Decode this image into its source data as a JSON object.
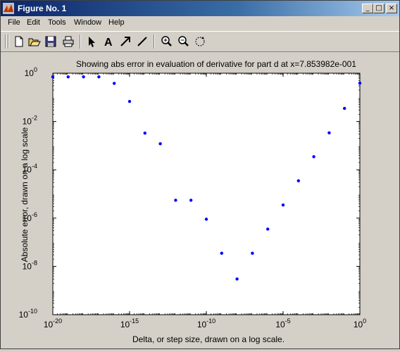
{
  "window": {
    "title": "Figure No. 1",
    "controls": {
      "minimize": "_",
      "maximize": "□",
      "close": "×"
    }
  },
  "menubar": [
    "File",
    "Edit",
    "Tools",
    "Window",
    "Help"
  ],
  "toolbar": [
    "new-file-icon",
    "open-folder-icon",
    "save-icon",
    "print-icon",
    "select-arrow-icon",
    "text-tool-icon",
    "arrow-tool-icon",
    "line-tool-icon",
    "zoom-in-icon",
    "zoom-out-icon",
    "rotate-icon"
  ],
  "chart_data": {
    "type": "scatter",
    "title": "Showing abs error in evaluation of derivative for part d at x=7.853982e-001",
    "xlabel": "Delta, or step size, drawn on a log scale.",
    "ylabel": "Absolute error, drawn on a log scale",
    "xscale": "log",
    "yscale": "log",
    "xlim": [
      1e-20,
      1
    ],
    "ylim": [
      1e-10,
      1
    ],
    "xticks": [
      {
        "value": 1e-20,
        "base": "10",
        "exp": "-20"
      },
      {
        "value": 1e-15,
        "base": "10",
        "exp": "-15"
      },
      {
        "value": 1e-10,
        "base": "10",
        "exp": "-10"
      },
      {
        "value": 1e-05,
        "base": "10",
        "exp": "-5"
      },
      {
        "value": 1,
        "base": "10",
        "exp": "0"
      }
    ],
    "yticks": [
      {
        "value": 1e-10,
        "base": "10",
        "exp": "-10"
      },
      {
        "value": 1e-08,
        "base": "10",
        "exp": "-8"
      },
      {
        "value": 1e-06,
        "base": "10",
        "exp": "-6"
      },
      {
        "value": 0.0001,
        "base": "10",
        "exp": "-4"
      },
      {
        "value": 0.01,
        "base": "10",
        "exp": "-2"
      },
      {
        "value": 1,
        "base": "10",
        "exp": "0"
      }
    ],
    "color": "#0000ff",
    "x": [
      1e-20,
      1e-19,
      1e-18,
      1e-17,
      1e-16,
      1e-15,
      1e-14,
      1e-13,
      1e-12,
      1e-11,
      1e-10,
      1e-09,
      1e-08,
      1e-07,
      1e-06,
      1e-05,
      0.0001,
      0.001,
      0.01,
      0.1,
      1
    ],
    "y": [
      0.707,
      0.707,
      0.707,
      0.707,
      0.38,
      0.068,
      0.0033,
      0.0012,
      5.5e-06,
      5.5e-06,
      9e-07,
      3.5e-08,
      3e-09,
      3.5e-08,
      3.5e-07,
      3.5e-06,
      3.5e-05,
      0.00035,
      0.0034,
      0.035,
      0.39
    ]
  }
}
